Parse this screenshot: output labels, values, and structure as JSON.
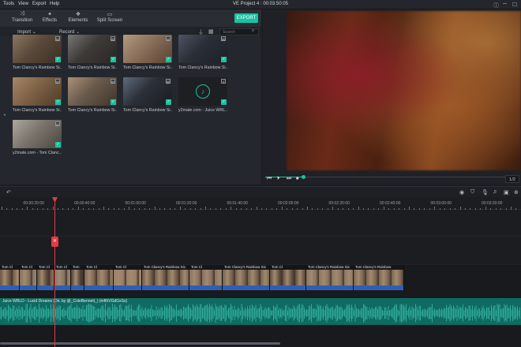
{
  "menubar": {
    "items": [
      "Tools",
      "View",
      "Export",
      "Help"
    ],
    "title": "VE Project 4 : 00:03:50:05"
  },
  "toolbar": {
    "tools": [
      {
        "label": "Transition",
        "icon": "transition-icon"
      },
      {
        "label": "Effects",
        "icon": "effects-icon"
      },
      {
        "label": "Elements",
        "icon": "elements-icon"
      },
      {
        "label": "Split Screen",
        "icon": "split-screen-icon"
      }
    ],
    "export_label": "EXPORT"
  },
  "subbar": {
    "import_label": "Import",
    "record_label": "Record",
    "search_placeholder": "Search"
  },
  "media": [
    {
      "name": "Tom Clancy's Rainbow Si...",
      "type": "video"
    },
    {
      "name": "Tom Clancy's Rainbow Si...",
      "type": "video"
    },
    {
      "name": "Tom Clancy's Rainbow Si...",
      "type": "video"
    },
    {
      "name": "Tom Clancy's Rainbow Si...",
      "type": "video"
    },
    {
      "name": "Tom Clancy's Rainbow Si...",
      "type": "video"
    },
    {
      "name": "Tom Clancy's Rainbow Si...",
      "type": "video"
    },
    {
      "name": "Tom Clancy's Rainbow Si...",
      "type": "video"
    },
    {
      "name": "y2mate.com - Juice WRL...",
      "type": "audio"
    },
    {
      "name": "y2mate.com - Tom Clanc...",
      "type": "video"
    }
  ],
  "preview": {
    "progress": 0.15,
    "page": "1/2"
  },
  "timeline": {
    "ruler": [
      "00:00:00:00",
      "00:00:20:00",
      "00:00:40:00",
      "00:01:00:00",
      "00:01:20:00",
      "00:01:40:00",
      "00:02:00:00",
      "00:02:20:00",
      "00:02:40:00",
      "00:03:00:00",
      "00:03:20:00"
    ],
    "video_clips": [
      "Tom Cl",
      "Tom Cl",
      "Tom Cl",
      "Tom Cl",
      "Tom",
      "Tom Cl",
      "Tom Cl",
      "Tom Clancy's Rainbow Six",
      "Tom Cl",
      "Tom Clancy's Rainbow Six",
      "Tom Cl",
      "Tom Clancy's Rainbow Six",
      "Tom Clancy's Rainbow"
    ],
    "audio_label": "Juice WRLD - Lucid Dreams (Dir. by @_ColeBennett_) (mfthVGdGxSs)"
  },
  "colors": {
    "accent": "#19c3a1",
    "playhead": "#e23b45",
    "audio": "#0f6b62",
    "video_wave": "#2f5fb5"
  }
}
